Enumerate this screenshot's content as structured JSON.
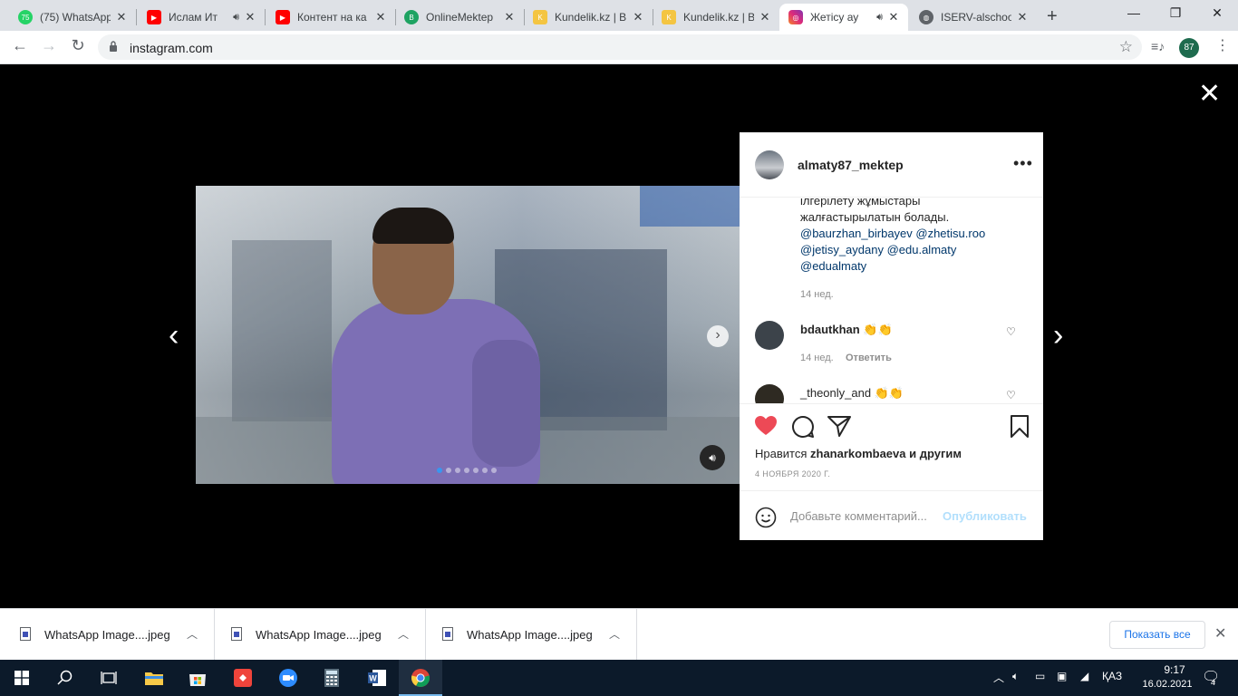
{
  "tabs": [
    {
      "title": "(75) WhatsApp",
      "icon": "whatsapp-icon",
      "badge": "75"
    },
    {
      "title": "Ислам Ит",
      "icon": "youtube-icon",
      "audio": true
    },
    {
      "title": "Контент на ка",
      "icon": "youtube-icon"
    },
    {
      "title": "OnlineMektep",
      "icon": "onlinemektep-icon"
    },
    {
      "title": "Kundelik.kz | B",
      "icon": "kundelik-icon"
    },
    {
      "title": "Kundelik.kz | B",
      "icon": "kundelik-icon"
    },
    {
      "title": "Жетісу ау",
      "icon": "instagram-icon",
      "audio": true,
      "active": true
    },
    {
      "title": "ISERV-alschoo",
      "icon": "globe-icon"
    }
  ],
  "window": {
    "minimize": "—",
    "maximize": "❐",
    "close": "✕"
  },
  "toolbar": {
    "url": "instagram.com",
    "profile_initials": "87"
  },
  "post": {
    "username": "almaty87_mektep",
    "caption_lines": [
      {
        "text": "ілгерілету жұмыстары",
        "mention": false
      },
      {
        "text": "жалғастырылатын болады.",
        "mention": false
      },
      {
        "text": "@baurzhan_birbayev @zhetisu.roo",
        "mention": true
      },
      {
        "text": "@jetisy_aydany @edu.almaty",
        "mention": true
      },
      {
        "text": "@edualmaty",
        "mention": true
      }
    ],
    "caption_time": "14 нед.",
    "comments": [
      {
        "user": "bdautkhan",
        "emoji": "👏👏",
        "time": "14 нед.",
        "reply": "Ответить"
      },
      {
        "user": "_theonly_and",
        "emoji": "👏👏",
        "time": "",
        "reply": ""
      }
    ],
    "likes_prefix": "Нравится",
    "likes_user": "zhanarkombaeva",
    "likes_suffix": "и другим",
    "date": "4 НОЯБРЯ 2020 Г.",
    "comment_placeholder": "Добавьте комментарий...",
    "publish_label": "Опубликовать",
    "carousel_dots": 7,
    "active_dot": 0,
    "liked": true,
    "heart_color": "#ed4956"
  },
  "downloads": {
    "items": [
      "WhatsApp Image....jpeg",
      "WhatsApp Image....jpeg",
      "WhatsApp Image....jpeg"
    ],
    "show_all": "Показать все"
  },
  "taskbar": {
    "apps": [
      "file-explorer-icon",
      "store-icon",
      "anydesk-icon",
      "zoom-icon",
      "calculator-icon",
      "word-icon",
      "chrome-icon"
    ],
    "lang": "ҚАЗ",
    "time": "9:17",
    "date": "16.02.2021",
    "notifications": "4"
  }
}
